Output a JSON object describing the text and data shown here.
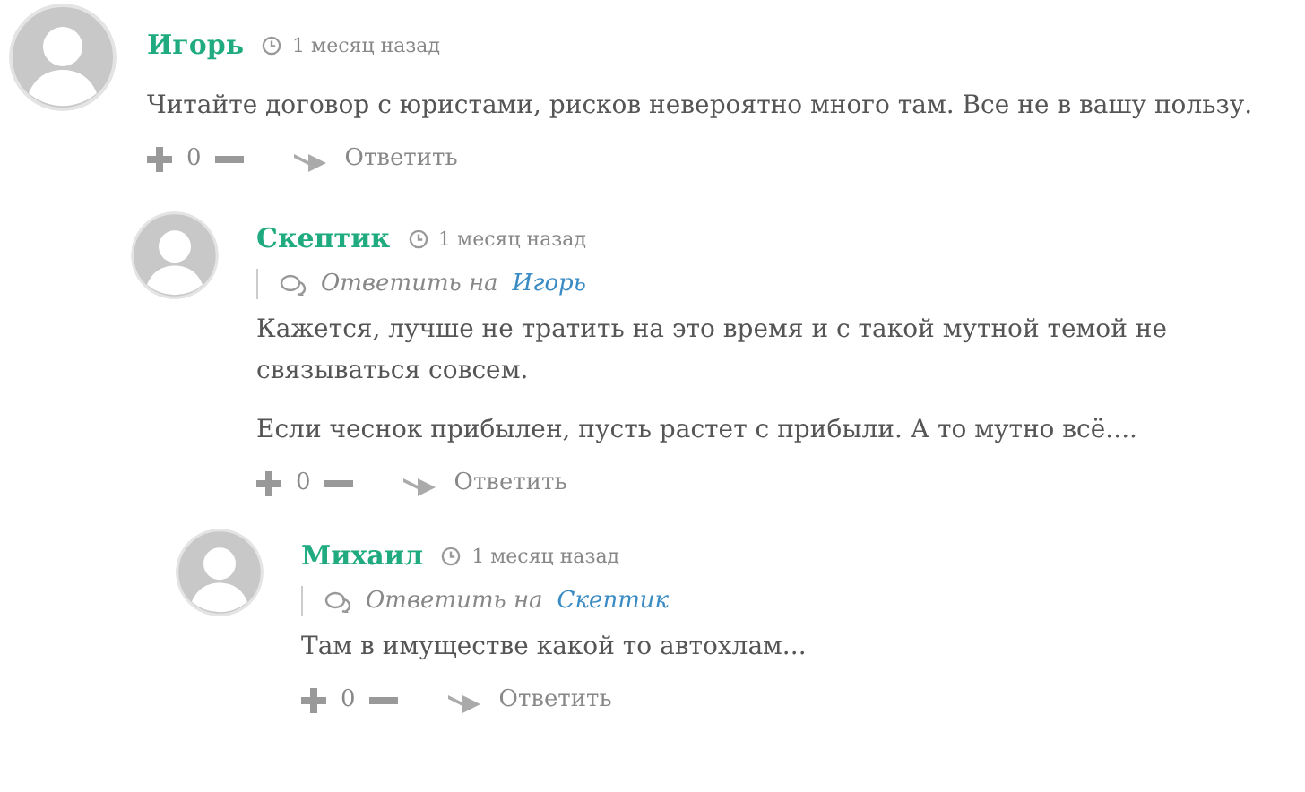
{
  "comments": [
    {
      "author": "Игорь",
      "time": "1 месяц назад",
      "paragraphs": [
        "Читайте договор с юристами, рисков невероятно много там. Все не в вашу пользу."
      ],
      "votes": "0",
      "reply_label": "Ответить",
      "children": [
        {
          "author": "Скептик",
          "time": "1 месяц назад",
          "reply_to": {
            "label": "Ответить на",
            "target": "Игорь"
          },
          "paragraphs": [
            "Кажется, лучше не тратить на это время и с такой мутной темой не связываться совсем.",
            "Если чеснок прибылен, пусть растет с прибыли. А то мутно всё...."
          ],
          "votes": "0",
          "reply_label": "Ответить",
          "children": [
            {
              "author": "Михаил",
              "time": "1 месяц назад",
              "reply_to": {
                "label": "Ответить на",
                "target": "Скептик"
              },
              "paragraphs": [
                "Там в имуществе какой то автохлам..."
              ],
              "votes": "0",
              "reply_label": "Ответить"
            }
          ]
        }
      ]
    }
  ]
}
